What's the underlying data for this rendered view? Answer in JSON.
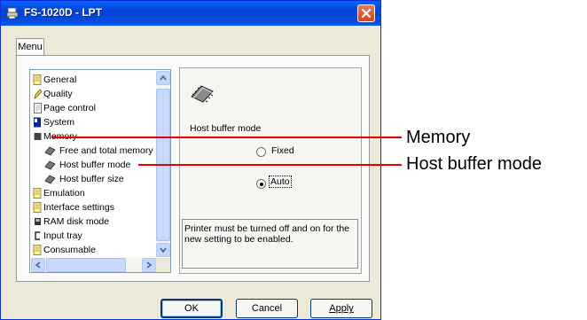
{
  "window": {
    "title": "FS-1020D - LPT",
    "title_icon": "printer-icon",
    "close_icon": "close-icon"
  },
  "tabs": [
    {
      "label": "Menu"
    }
  ],
  "tree": {
    "items": [
      {
        "label": "General",
        "icon": "document-icon"
      },
      {
        "label": "Quality",
        "icon": "pencil-icon"
      },
      {
        "label": "Page control",
        "icon": "page-icon"
      },
      {
        "label": "System",
        "icon": "computer-icon"
      },
      {
        "label": "Memory",
        "icon": "memory-icon"
      },
      {
        "label": "Free and total memory",
        "icon": "chip-icon"
      },
      {
        "label": "Host buffer mode",
        "icon": "chip-icon"
      },
      {
        "label": "Host buffer size",
        "icon": "chip-icon"
      },
      {
        "label": "Emulation",
        "icon": "document-icon"
      },
      {
        "label": "Interface settings",
        "icon": "document-icon"
      },
      {
        "label": "RAM disk mode",
        "icon": "disk-icon"
      },
      {
        "label": "Input tray",
        "icon": "tray-icon"
      },
      {
        "label": "Consumable",
        "icon": "document-icon"
      }
    ]
  },
  "panel": {
    "icon": "memory-chip-icon",
    "heading": "Host buffer mode",
    "options": [
      {
        "label": "Fixed",
        "checked": false
      },
      {
        "label": "Auto",
        "checked": true
      }
    ],
    "notice": "Printer must be turned off and on for the new setting to be enabled."
  },
  "buttons": {
    "ok": "OK",
    "cancel": "Cancel",
    "apply": "Apply"
  },
  "callouts": [
    {
      "label": "Memory",
      "color": "#e00000"
    },
    {
      "label": "Host buffer mode",
      "color": "#e00000"
    }
  ]
}
